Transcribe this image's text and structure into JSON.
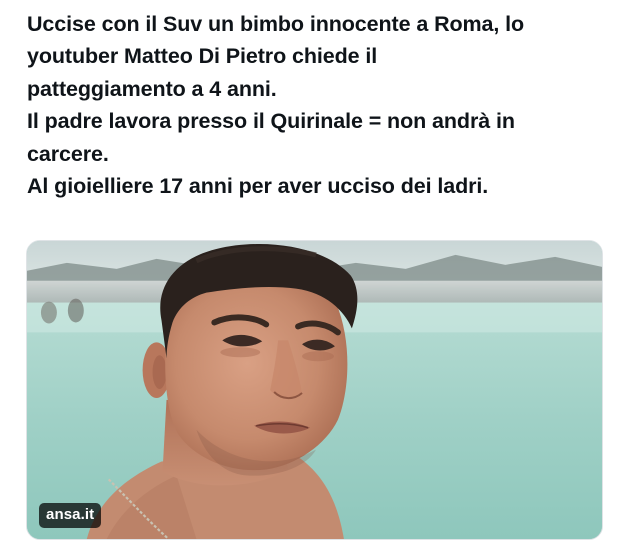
{
  "post": {
    "text_lines": [
      "Uccise con il Suv un bimbo innocente a Roma, lo",
      "youtuber Matteo Di Pietro chiede il",
      "patteggiamento a 4 anni.",
      "Il padre lavora presso il Quirinale = non andrà in",
      "carcere.",
      "Al gioielliere 17 anni per aver ucciso dei ladri."
    ]
  },
  "media": {
    "source_label": "ansa.it",
    "image_icon": "photo-icon"
  },
  "colors": {
    "text": "#0f1419",
    "background": "#ffffff",
    "badge_bg": "#000000",
    "badge_text": "#ffffff",
    "water": "#a3d2c8",
    "sky": "#dde6e6"
  }
}
